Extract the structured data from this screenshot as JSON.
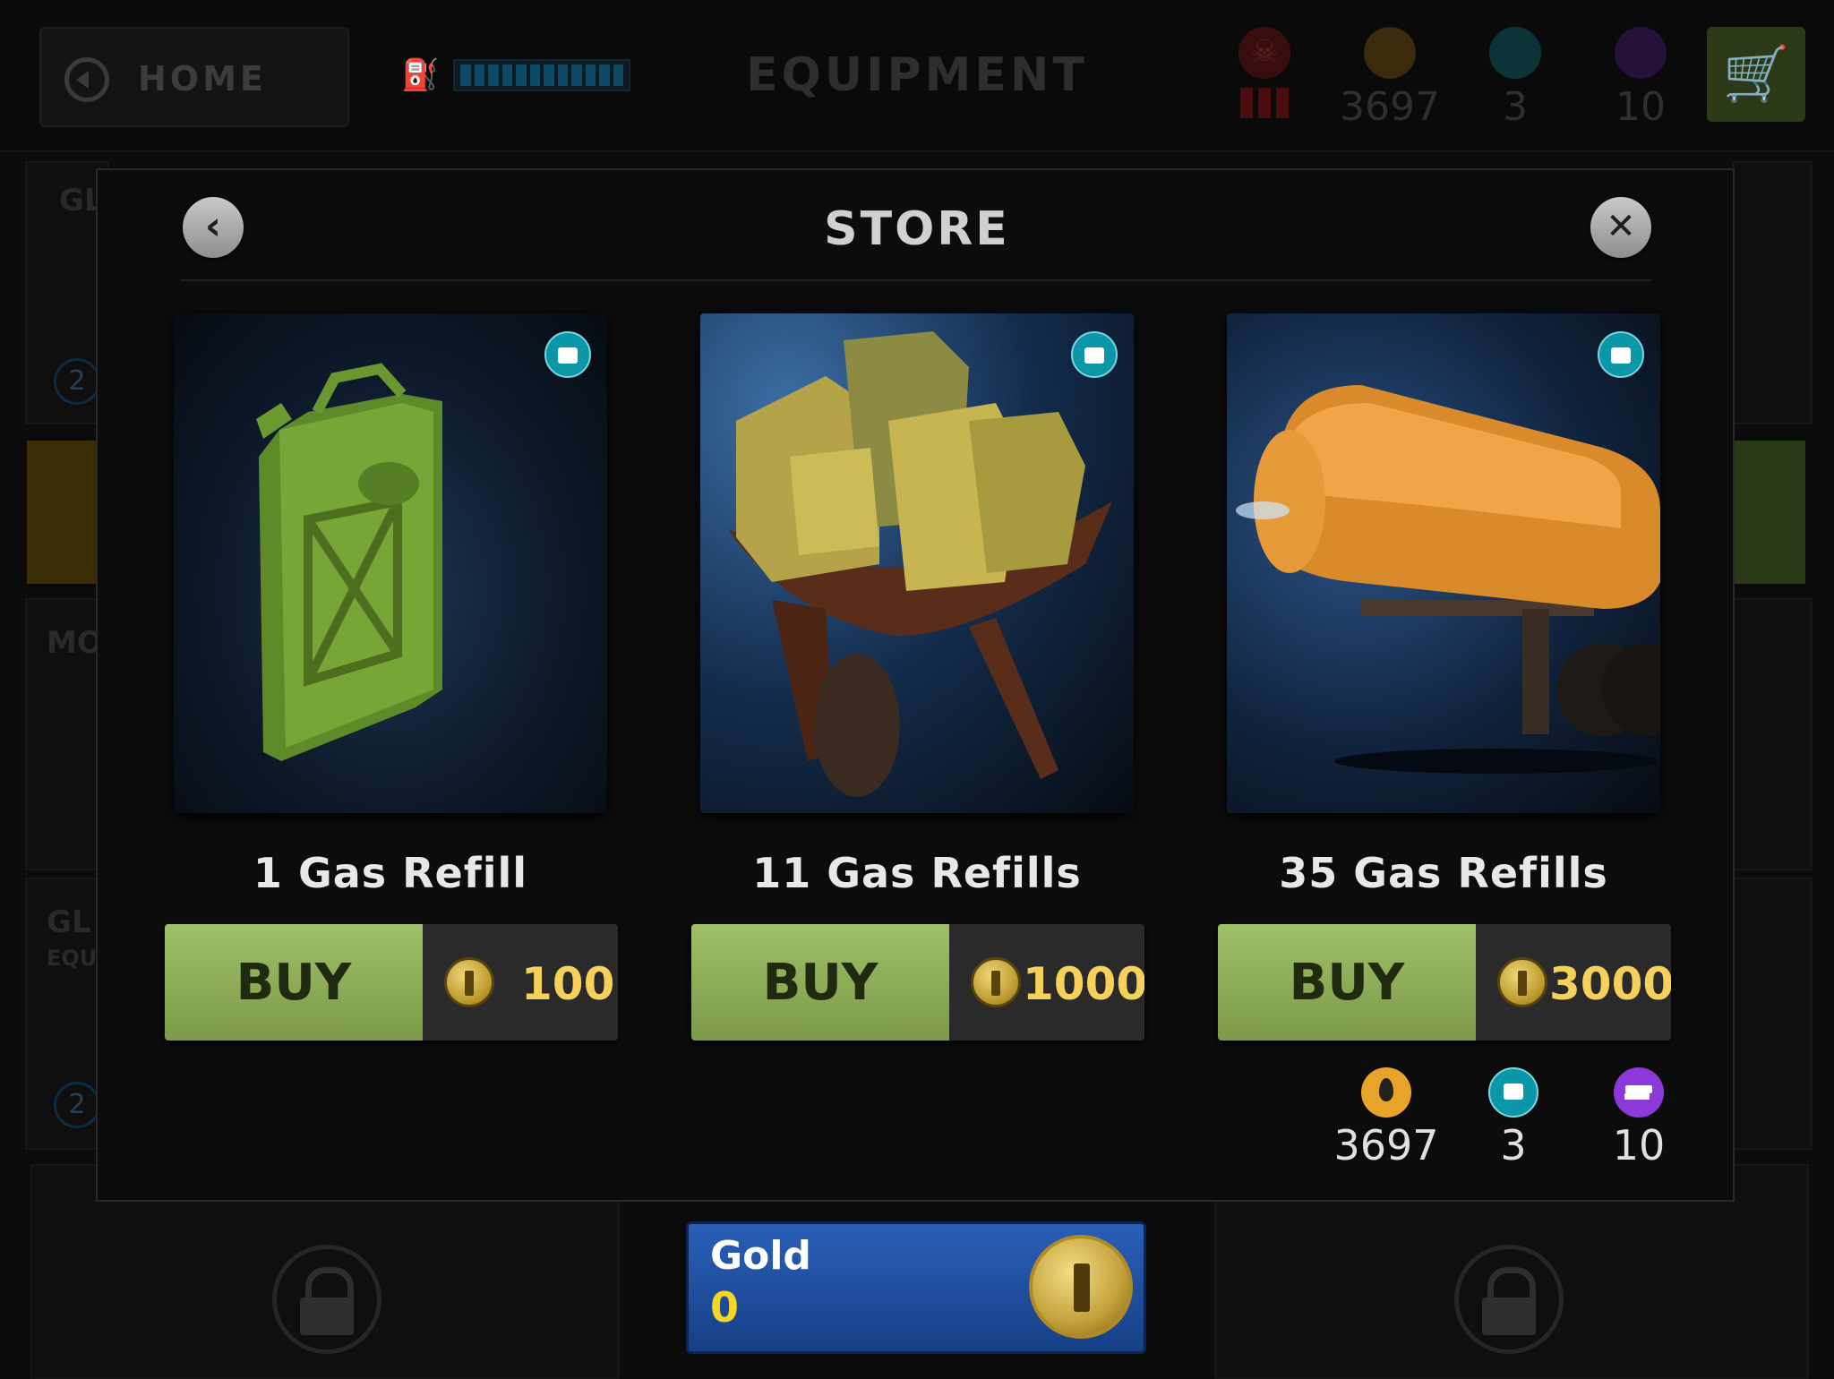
{
  "topbar": {
    "home_label": "HOME",
    "title": "EQUIPMENT",
    "fuel_segments": 12,
    "stats": [
      {
        "name": "skull",
        "value": ""
      },
      {
        "name": "oil",
        "value": "3697"
      },
      {
        "name": "gas-can",
        "value": "3"
      },
      {
        "name": "revolver",
        "value": "10"
      }
    ]
  },
  "background": {
    "panel_labels": [
      "GL",
      "MO",
      "GL",
      "EQU"
    ],
    "badges": [
      "2",
      "2"
    ]
  },
  "store": {
    "title": "STORE",
    "items": [
      {
        "name": "1 Gas Refill",
        "buy_label": "BUY",
        "price": "100"
      },
      {
        "name": "11 Gas Refills",
        "buy_label": "BUY",
        "price": "1000"
      },
      {
        "name": "35 Gas Refills",
        "buy_label": "BUY",
        "price": "3000"
      }
    ],
    "resources": [
      {
        "icon": "oil-drop-icon",
        "value": "3697"
      },
      {
        "icon": "gas-can-icon",
        "value": "3"
      },
      {
        "icon": "revolver-icon",
        "value": "10"
      }
    ]
  },
  "gold": {
    "label": "Gold",
    "value": "0"
  }
}
